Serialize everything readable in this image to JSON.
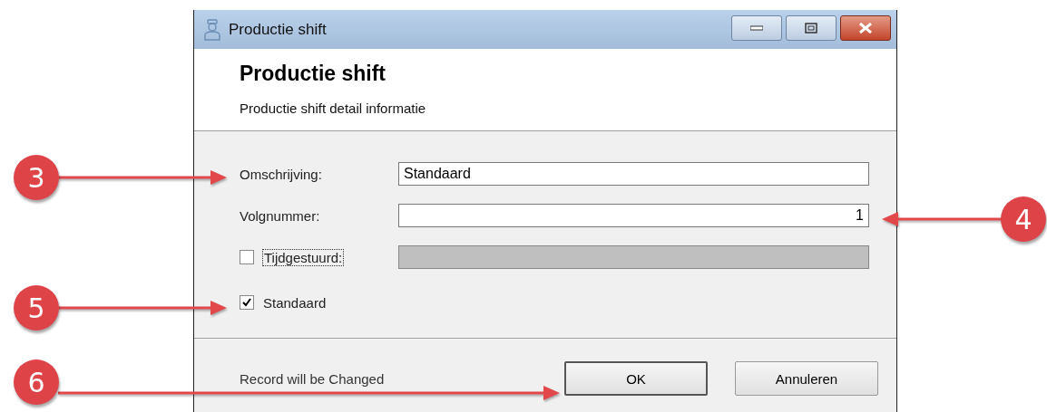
{
  "window": {
    "title": "Productie shift"
  },
  "header": {
    "title": "Productie shift",
    "subtitle": "Productie shift detail informatie"
  },
  "fields": [
    {
      "kind": "text",
      "label": "Omschrijving:",
      "value": "Standaard"
    },
    {
      "kind": "number",
      "label": "Volgnummer:",
      "value": "1"
    },
    {
      "kind": "checkfield",
      "label": "Tijdgestuurd:",
      "checked": false,
      "disabled": true
    },
    {
      "kind": "check",
      "label": "Standaard",
      "checked": true
    }
  ],
  "status": "Record will be Changed",
  "buttons": [
    "OK",
    "Annuleren"
  ],
  "callouts": [
    {
      "label": "3"
    },
    {
      "label": "4"
    },
    {
      "label": "5"
    },
    {
      "label": "6"
    }
  ]
}
